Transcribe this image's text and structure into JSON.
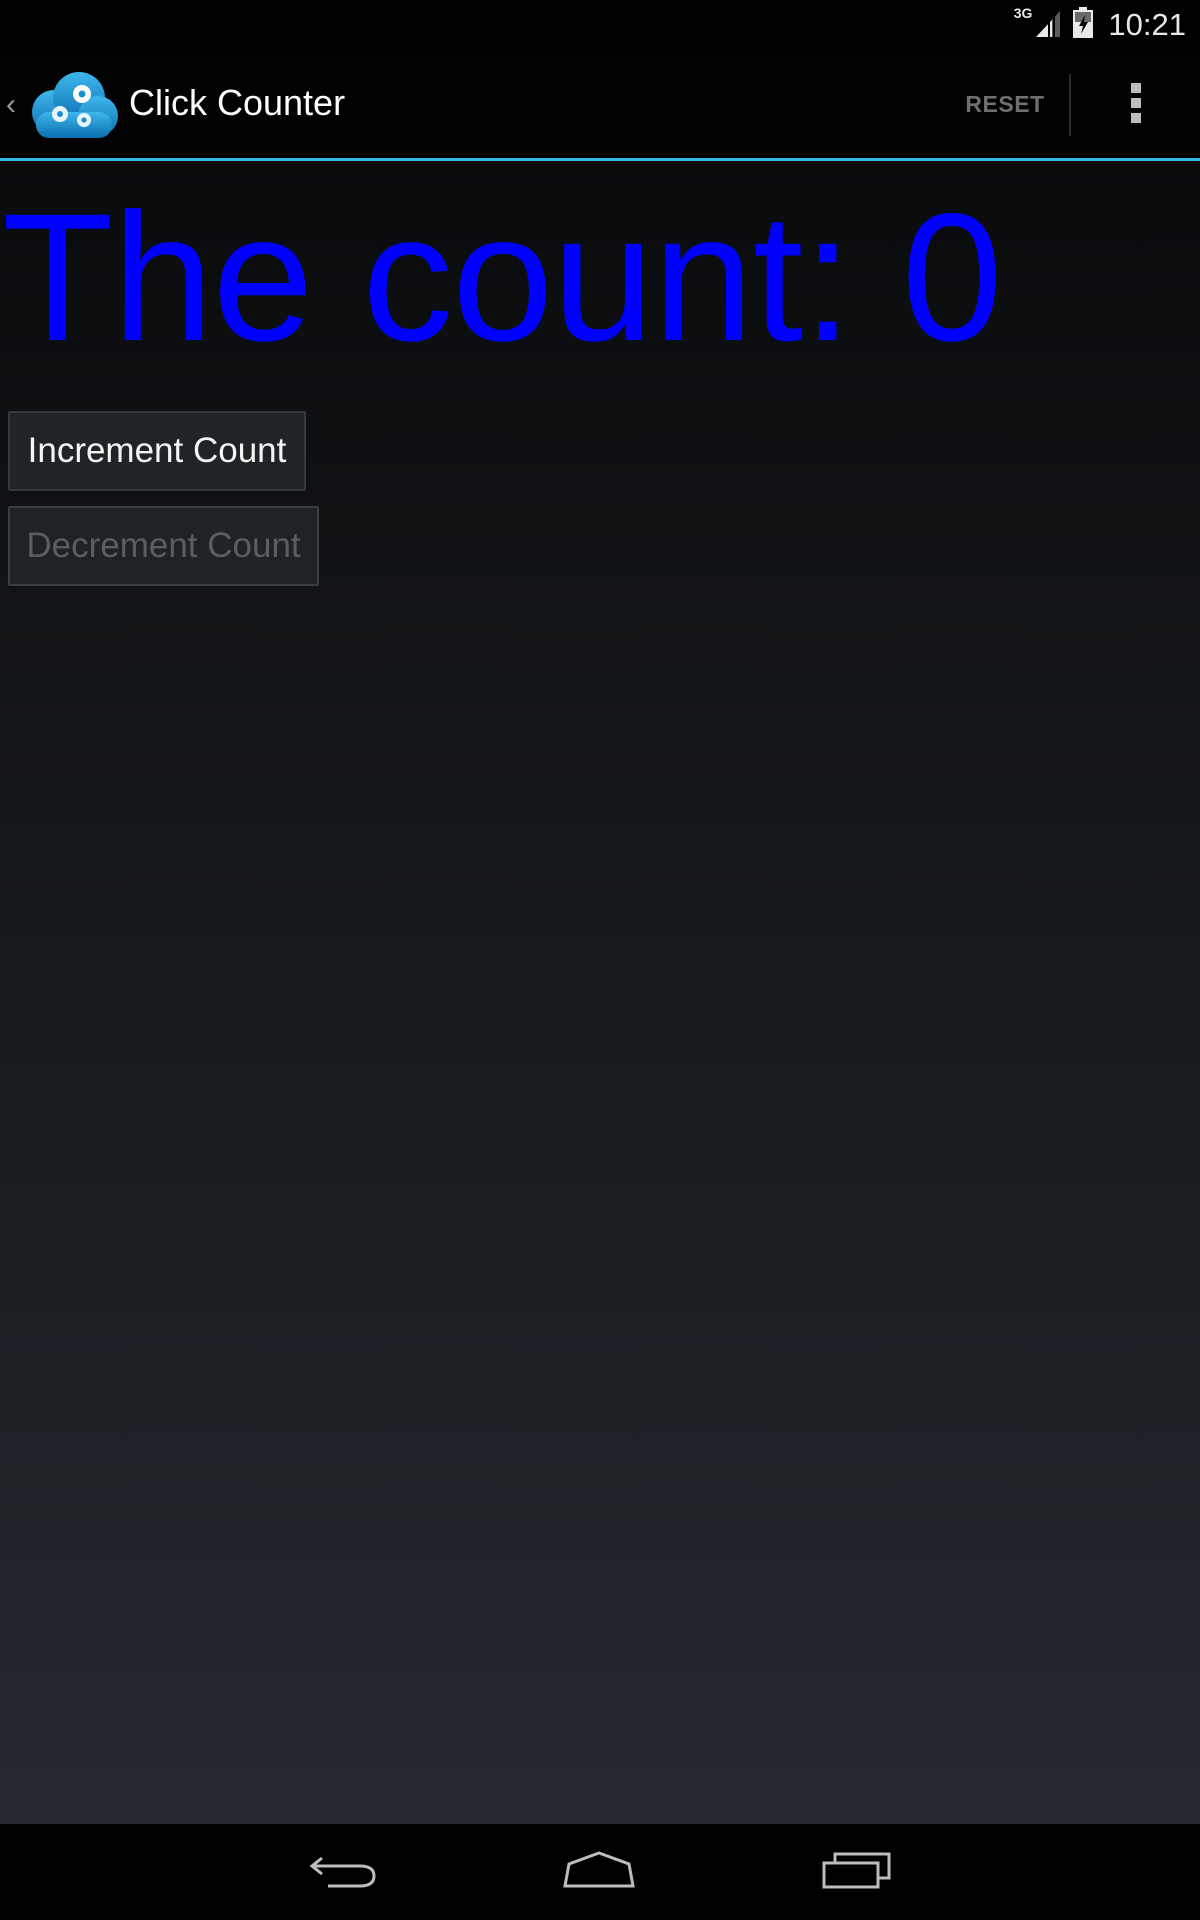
{
  "status_bar": {
    "network": "3G",
    "time": "10:21"
  },
  "action_bar": {
    "title": "Click Counter",
    "reset_label": "RESET",
    "accent_color": "#33b5e5"
  },
  "main": {
    "count_text": "The count: 0",
    "count_color": "#0000ff",
    "increment_label": "Increment Count",
    "decrement_label": "Decrement Count",
    "decrement_enabled": false
  }
}
